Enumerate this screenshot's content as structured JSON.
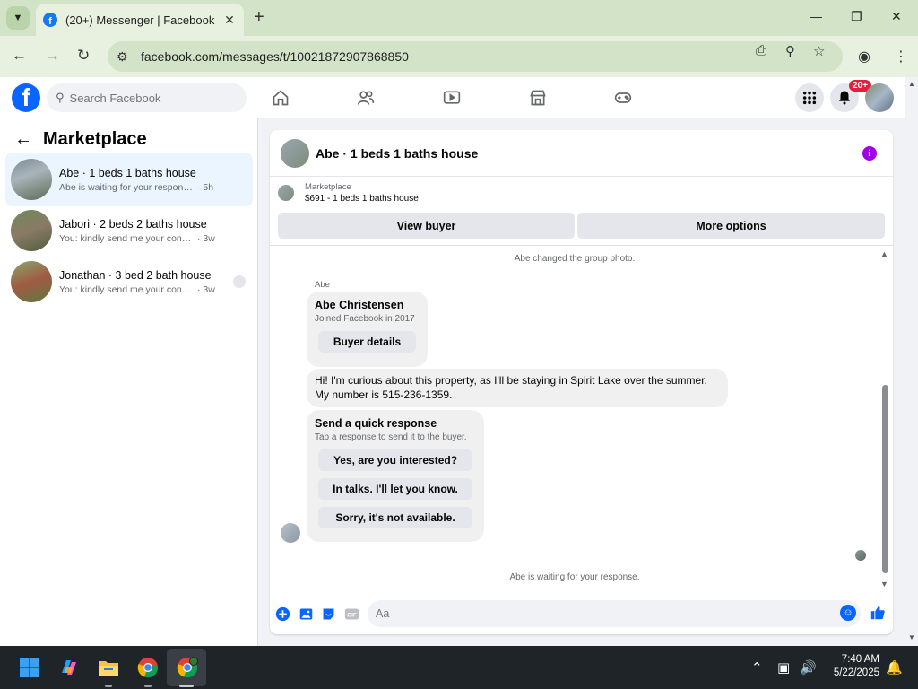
{
  "browser": {
    "tab_title": "(20+) Messenger | Facebook",
    "url": "facebook.com/messages/t/10021872907868850"
  },
  "fb": {
    "search_placeholder": "Search Facebook",
    "notif_badge": "20+"
  },
  "left": {
    "title": "Marketplace",
    "conversations": [
      {
        "name": "Abe · 1 beds 1 baths house",
        "snippet": "Abe is waiting for your response.",
        "time": "· 5h"
      },
      {
        "name": "Jabori · 2 beds 2 baths house",
        "snippet": "You: kindly send me your contact nu...",
        "time": "· 3w"
      },
      {
        "name": "Jonathan · 3 bed 2 bath house",
        "snippet": "You: kindly send me your contact n...",
        "time": "· 3w"
      }
    ]
  },
  "chat": {
    "title": "Abe · 1 beds 1 baths house",
    "mp_label": "Marketplace",
    "listing": "$691 - 1 beds 1 baths house",
    "view_buyer": "View buyer",
    "more_options": "More options",
    "sys_photo": "Abe changed the group photo.",
    "sender": "Abe",
    "buyer_name": "Abe Christensen",
    "buyer_joined": "Joined Facebook in 2017",
    "buyer_details": "Buyer details",
    "message_line1": "Hi! I'm curious about this property, as I'll be staying in Spirit Lake over the summer.",
    "message_line2": "My number is 515-236-1359.",
    "quick_title": "Send a quick response",
    "quick_sub": "Tap a response to send it to the buyer.",
    "quick_1": "Yes, are you interested?",
    "quick_2": "In talks. I'll let you know.",
    "quick_3": "Sorry, it's not available.",
    "waiting": "Abe is waiting for your response.",
    "composer_placeholder": "Aa"
  },
  "taskbar": {
    "time": "7:40 AM",
    "date": "5/22/2025"
  },
  "colors": {
    "fb_blue": "#0866ff",
    "active_row": "#ebf5ff",
    "chrome_tab": "#d3e3c8",
    "badge_red": "#e41e3f",
    "info_purple": "#a100e6"
  }
}
